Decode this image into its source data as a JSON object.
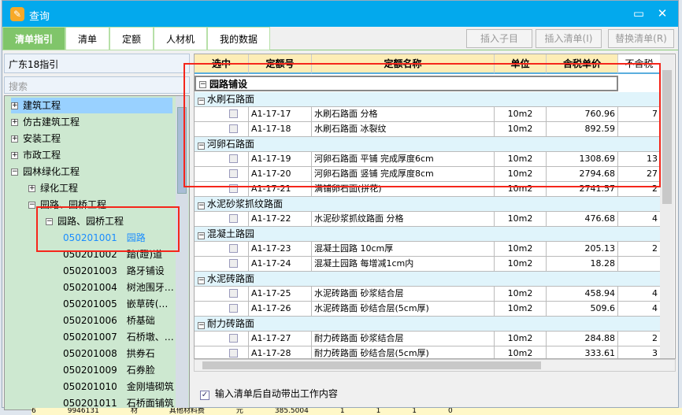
{
  "title": "查询",
  "tabs": [
    "清单指引",
    "清单",
    "定额",
    "人材机",
    "我的数据"
  ],
  "toolbar": {
    "insert_sub": "插入子目",
    "insert_list": "插入清单(I)",
    "replace_list": "替换清单(R)"
  },
  "left": {
    "dropdown": "广东18指引",
    "search_placeholder": "搜索",
    "tree": [
      {
        "label": "建筑工程",
        "lvl": 0,
        "pm": "+"
      },
      {
        "label": "仿古建筑工程",
        "lvl": 0,
        "pm": "+"
      },
      {
        "label": "安装工程",
        "lvl": 0,
        "pm": "+"
      },
      {
        "label": "市政工程",
        "lvl": 0,
        "pm": "+"
      },
      {
        "label": "园林绿化工程",
        "lvl": 0,
        "pm": "-"
      },
      {
        "label": "绿化工程",
        "lvl": 1,
        "pm": "+"
      },
      {
        "label": "园路、园桥工程",
        "lvl": 1,
        "pm": "-"
      },
      {
        "label": "园路、园桥工程",
        "lvl": 2,
        "pm": "-"
      }
    ],
    "leaves": [
      {
        "code": "050201001",
        "name": "园路"
      },
      {
        "code": "050201002",
        "name": "踏(蹬)道"
      },
      {
        "code": "050201003",
        "name": "路牙铺设"
      },
      {
        "code": "050201004",
        "name": "树池围牙…"
      },
      {
        "code": "050201005",
        "name": "嵌草砖(…"
      },
      {
        "code": "050201006",
        "name": "桥基础"
      },
      {
        "code": "050201007",
        "name": "石桥墩、…"
      },
      {
        "code": "050201008",
        "name": "拱券石"
      },
      {
        "code": "050201009",
        "name": "石券脸"
      },
      {
        "code": "050201010",
        "name": "金刚墙砌筑"
      },
      {
        "code": "050201011",
        "name": "石桥面铺筑"
      }
    ]
  },
  "grid": {
    "headers": [
      "选中",
      "定额号",
      "定额名称",
      "单位",
      "含税单价",
      "不含税"
    ],
    "top_group": "园路铺设",
    "rows": [
      {
        "g": "水刷石路面"
      },
      {
        "code": "A1-17-17",
        "name": "水刷石路面 分格",
        "unit": "10m2",
        "price": "760.96",
        "p2": "7"
      },
      {
        "code": "A1-17-18",
        "name": "水刷石路面 冰裂纹",
        "unit": "10m2",
        "price": "892.59",
        "p2": ""
      },
      {
        "g": "河卵石路面"
      },
      {
        "code": "A1-17-19",
        "name": "河卵石路面 平铺 完成厚度6cm",
        "unit": "10m2",
        "price": "1308.69",
        "p2": "13"
      },
      {
        "code": "A1-17-20",
        "name": "河卵石路面 竖铺 完成厚度8cm",
        "unit": "10m2",
        "price": "2794.68",
        "p2": "27"
      },
      {
        "code": "A1-17-21",
        "name": "满铺卵石面(拼花)",
        "unit": "10m2",
        "price": "2741.57",
        "p2": "2"
      },
      {
        "g": "水泥砂浆抓纹路面"
      },
      {
        "code": "A1-17-22",
        "name": "水泥砂浆抓纹路面 分格",
        "unit": "10m2",
        "price": "476.68",
        "p2": "4"
      },
      {
        "g": "混凝土路园"
      },
      {
        "code": "A1-17-23",
        "name": "混凝土园路 10cm厚",
        "unit": "10m2",
        "price": "205.13",
        "p2": "2"
      },
      {
        "code": "A1-17-24",
        "name": "混凝土园路 每增减1cm内",
        "unit": "10m2",
        "price": "18.28",
        "p2": ""
      },
      {
        "g": "水泥砖路面"
      },
      {
        "code": "A1-17-25",
        "name": "水泥砖路面 砂浆结合层",
        "unit": "10m2",
        "price": "458.94",
        "p2": "4"
      },
      {
        "code": "A1-17-26",
        "name": "水泥砖路面 砂结合层(5cm厚)",
        "unit": "10m2",
        "price": "509.6",
        "p2": "4"
      },
      {
        "g": "耐力砖路面"
      },
      {
        "code": "A1-17-27",
        "name": "耐力砖路面 砂浆结合层",
        "unit": "10m2",
        "price": "284.88",
        "p2": "2"
      },
      {
        "code": "A1-17-28",
        "name": "耐力砖路面 砂结合层(5cm厚)",
        "unit": "10m2",
        "price": "333.61",
        "p2": "3"
      }
    ]
  },
  "auto_option": "输入清单后自动带出工作内容",
  "bg_row": [
    "6",
    "9946131",
    "材",
    "其他材料费",
    "元",
    "385.5004",
    "1",
    "1",
    "1",
    "0"
  ],
  "colors": {
    "title": "#03a9ed",
    "tab_active": "#80c56a",
    "highlight": "#f5261b"
  }
}
